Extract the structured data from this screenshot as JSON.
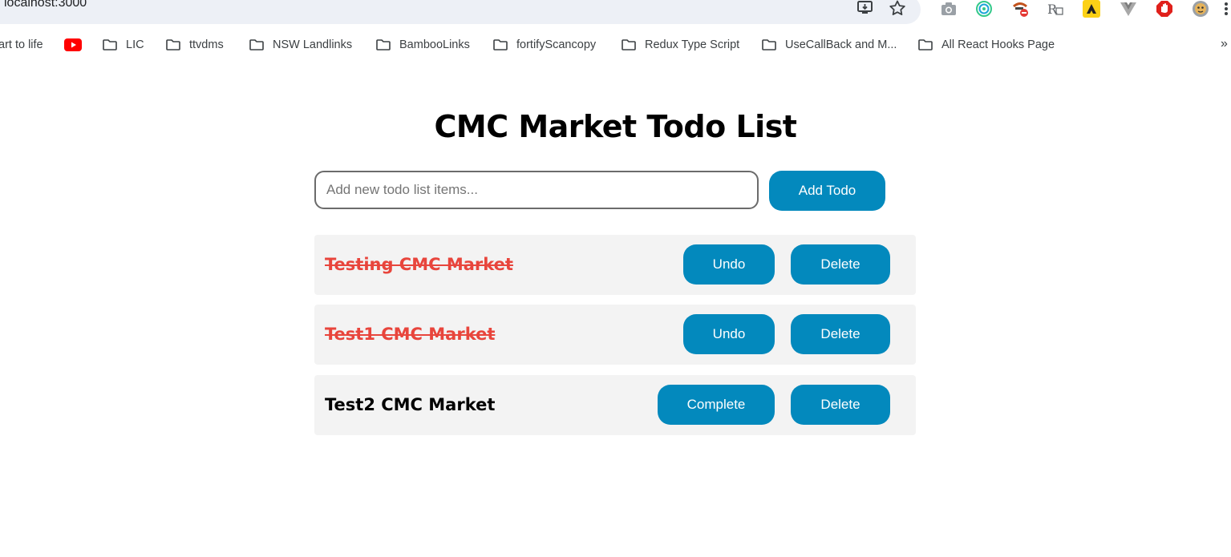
{
  "browser": {
    "url": "localhost:3000",
    "bookmarks": [
      {
        "label": "art to life",
        "type": "link"
      },
      {
        "label": "",
        "type": "youtube"
      },
      {
        "label": "LIC",
        "type": "folder"
      },
      {
        "label": "ttvdms",
        "type": "folder"
      },
      {
        "label": "NSW Landlinks",
        "type": "folder"
      },
      {
        "label": "BambooLinks",
        "type": "folder"
      },
      {
        "label": "fortifyScancopy",
        "type": "folder"
      },
      {
        "label": "Redux Type Script",
        "type": "folder"
      },
      {
        "label": "UseCallBack and M...",
        "type": "folder"
      },
      {
        "label": "All React Hooks Page",
        "type": "folder"
      }
    ],
    "more_bookmarks": "»"
  },
  "app": {
    "title": "CMC Market Todo List",
    "input": {
      "value": "",
      "placeholder": "Add new todo list items..."
    },
    "add_button": "Add Todo",
    "todos": [
      {
        "text": "Testing CMC Market",
        "completed": true,
        "toggle_label": "Undo",
        "delete_label": "Delete"
      },
      {
        "text": "Test1 CMC Market",
        "completed": true,
        "toggle_label": "Undo",
        "delete_label": "Delete"
      },
      {
        "text": "Test2 CMC Market",
        "completed": false,
        "toggle_label": "Complete",
        "delete_label": "Delete"
      }
    ]
  },
  "colors": {
    "button": "#0389bd",
    "completed_text": "#e8453c",
    "item_bg": "#f3f3f3",
    "omnibox_bg": "#edf0f6"
  }
}
